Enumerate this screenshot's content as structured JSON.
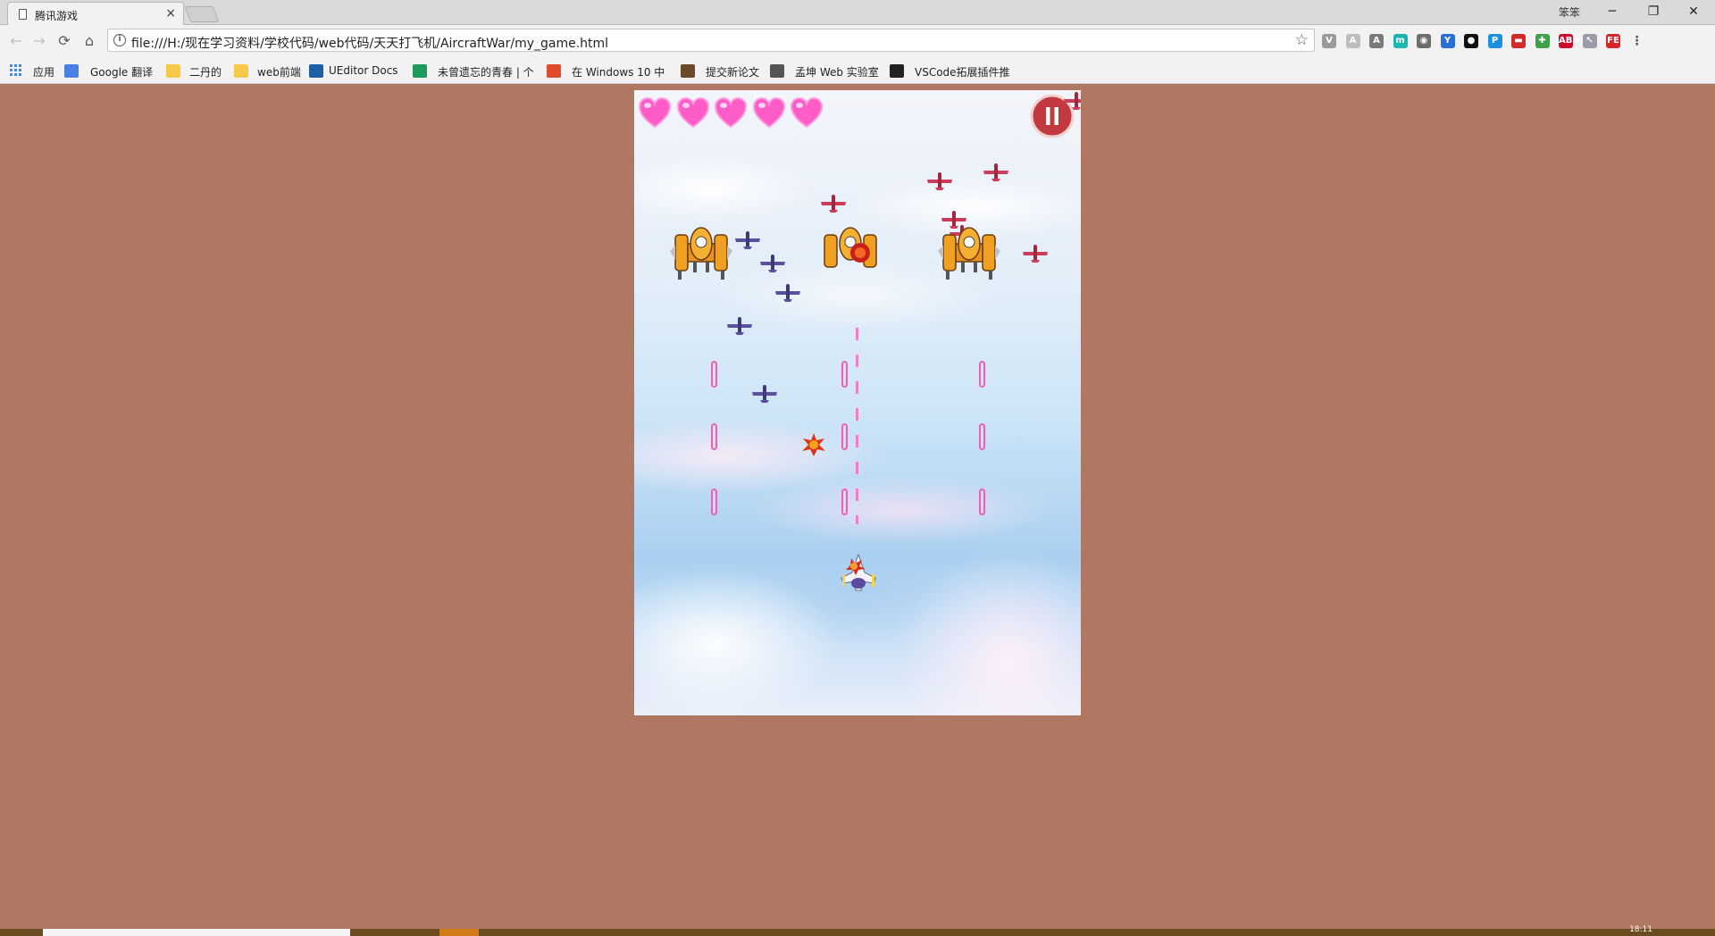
{
  "browser": {
    "tab_title": "腾讯游戏",
    "tab_close": "×",
    "url": "file:///H:/现在学习资料/学校代码/web代码/天天打飞机/AircraftWar/my_game.html",
    "window_user": "笨笨",
    "window_buttons": [
      "─",
      "❐",
      "✕"
    ]
  },
  "nav": {
    "back": "←",
    "forward": "→",
    "reload": "⟳",
    "home": "⌂",
    "star": "☆"
  },
  "extensions": [
    {
      "name": "vue-icon",
      "label": "V",
      "color": "#9a9a9a"
    },
    {
      "name": "ext-a-icon",
      "label": "A",
      "color": "#bdbdbd"
    },
    {
      "name": "angular-icon",
      "label": "A",
      "color": "#7a7a7a"
    },
    {
      "name": "m-icon",
      "label": "m",
      "color": "#1ab7b0"
    },
    {
      "name": "ghostery-icon",
      "label": "◉",
      "color": "#6d6d6d"
    },
    {
      "name": "y-icon",
      "label": "Y",
      "color": "#2a6fd6"
    },
    {
      "name": "record-icon",
      "label": "●",
      "color": "#111111"
    },
    {
      "name": "search-ext-icon",
      "label": "P",
      "color": "#1b8fe0"
    },
    {
      "name": "red-ext-icon",
      "label": "▬",
      "color": "#d02a2a"
    },
    {
      "name": "colorzilla-icon",
      "label": "✚",
      "color": "#41a04a"
    },
    {
      "name": "abp-icon",
      "label": "ABP",
      "color": "#c8102e"
    },
    {
      "name": "cursor-ext-icon",
      "label": "↖",
      "color": "#9a9aa8"
    },
    {
      "name": "fe-icon",
      "label": "FE",
      "color": "#d6262a"
    },
    {
      "name": "menu-icon",
      "label": "⋮",
      "color": "#f2f2f2"
    }
  ],
  "bookmarks": [
    {
      "name": "apps",
      "label": "应用",
      "icon": "apps-grid-icon",
      "icon_color": "#4285f4"
    },
    {
      "name": "google-translate",
      "label": "Google 翻译",
      "icon": "translate-icon",
      "icon_color": "#4a7fe8"
    },
    {
      "name": "erdan",
      "label": "二丹的",
      "icon": "folder-icon",
      "icon_color": "#f7c948"
    },
    {
      "name": "web-frontend",
      "label": "web前端",
      "icon": "folder-icon",
      "icon_color": "#f7c948"
    },
    {
      "name": "ueditor",
      "label": "UEditor Docs",
      "icon": "ueditor-icon",
      "icon_color": "#1f5fa6"
    },
    {
      "name": "youth",
      "label": "未曾遗忘的青春 | 个",
      "icon": "site-icon",
      "icon_color": "#1e9a5a"
    },
    {
      "name": "windows10",
      "label": "在 Windows 10 中",
      "icon": "windows-icon",
      "icon_color": "#e04b2b"
    },
    {
      "name": "thesis",
      "label": "提交新论文",
      "icon": "thesis-icon",
      "icon_color": "#6a4a2a"
    },
    {
      "name": "mengkun",
      "label": "孟坤 Web 实验室",
      "icon": "tools-icon",
      "icon_color": "#555555"
    },
    {
      "name": "vscode-ext",
      "label": "VSCode拓展插件推",
      "icon": "github-icon",
      "icon_color": "#222222"
    }
  ],
  "game": {
    "lives": 5,
    "heart_color": "#ff5cc8",
    "pause_color": "#c2393f",
    "pause_label": "pause"
  },
  "taskbar": {
    "clock": "18:11"
  }
}
